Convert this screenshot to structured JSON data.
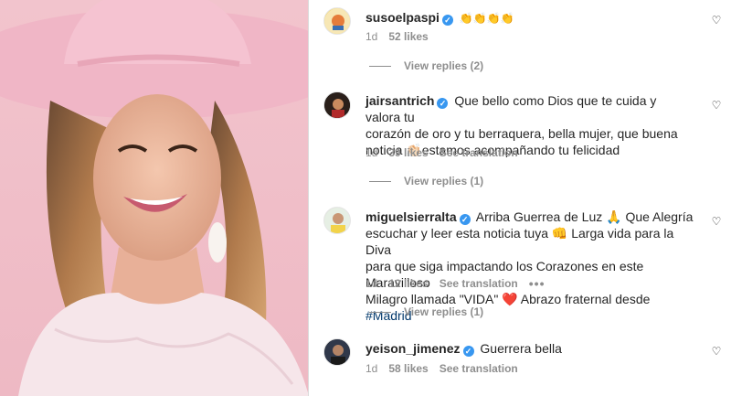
{
  "comments": [
    {
      "username": "susoelpaspi",
      "verified": true,
      "text_lines": [
        "👏👏👏👏"
      ],
      "time": "1d",
      "likes": "52 likes",
      "see_translation": "",
      "view_replies": "View replies (2)"
    },
    {
      "username": "jairsantrich",
      "verified": true,
      "text_lines": [
        "Que bello como Dios que te cuida y valora tu",
        "corazón de oro y tu berraquera, bella mujer, que buena",
        "noticia 👏🏻estamos acompañando tu felicidad"
      ],
      "time": "1d",
      "likes": "39 likes",
      "see_translation": "See translation",
      "view_replies": "View replies (1)"
    },
    {
      "username": "miguelsierralta",
      "verified": true,
      "text_lines": [
        "Arriba Guerrea de Luz 🙏 Que Alegría",
        "escuchar y leer esta noticia tuya 👊 Larga vida para la Diva",
        "para que siga impactando los Corazones en este Maravilloso",
        "Milagro llamada \"VIDA\" ❤️ Abrazo fraternal desde "
      ],
      "hashtag": "#Madrid",
      "time": "1d",
      "likes": "12 likes",
      "see_translation": "See translation",
      "more": "•••",
      "view_replies": "View replies (1)"
    },
    {
      "username": "yeison_jimenez",
      "verified": true,
      "text_lines": [
        "Guerrera bella"
      ],
      "time": "1d",
      "likes": "58 likes",
      "see_translation": "See translation",
      "view_replies": ""
    }
  ],
  "icons": {
    "like": "heart-outline-icon",
    "verified": "verified-badge-icon"
  },
  "verified_mark": "✓",
  "heart_glyph": "♡",
  "colors": {
    "link_blue": "#00376b",
    "verified_blue": "#3897f0",
    "secondary_text": "#8e8e8e",
    "photo_bg": "#f3c6cf"
  }
}
